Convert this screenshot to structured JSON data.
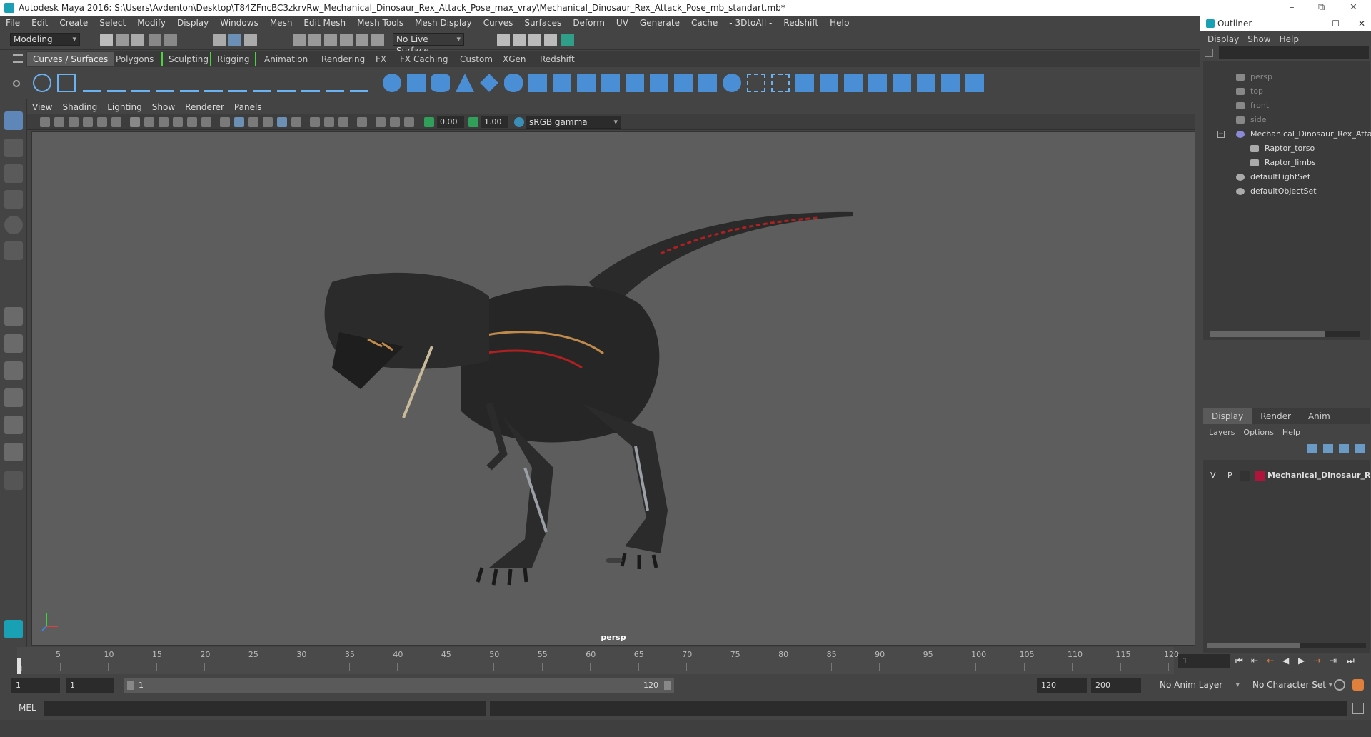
{
  "window": {
    "title": "Autodesk Maya 2016: S:\\Users\\Avdenton\\Desktop\\T84ZFncBC3zkrvRw_Mechanical_Dinosaur_Rex_Attack_Pose_max_vray\\Mechanical_Dinosaur_Rex_Attack_Pose_mb_standart.mb*",
    "controls": [
      "–",
      "⧉",
      "✕"
    ]
  },
  "menubar": [
    "File",
    "Edit",
    "Create",
    "Select",
    "Modify",
    "Display",
    "Windows",
    "Mesh",
    "Edit Mesh",
    "Mesh Tools",
    "Mesh Display",
    "Curves",
    "Surfaces",
    "Deform",
    "UV",
    "Generate",
    "Cache",
    "- 3DtoAll -",
    "Redshift",
    "Help"
  ],
  "statusline": {
    "workspace": "Modeling",
    "live_surface": "No Live Surface"
  },
  "shelf": {
    "tabs": [
      "Curves / Surfaces",
      "Polygons",
      "Sculpting",
      "Rigging",
      "Animation",
      "Rendering",
      "FX",
      "FX Caching",
      "Custom",
      "XGen",
      "Redshift"
    ],
    "active_tab": "Curves / Surfaces"
  },
  "viewport": {
    "menu": [
      "View",
      "Shading",
      "Lighting",
      "Show",
      "Renderer",
      "Panels"
    ],
    "exposure": "0.00",
    "gamma": "1.00",
    "color_space": "sRGB gamma",
    "camera_label": "persp"
  },
  "outliner": {
    "title": "Outliner",
    "menu": [
      "Display",
      "Show",
      "Help"
    ],
    "items": [
      {
        "label": "persp",
        "dim": true
      },
      {
        "label": "top",
        "dim": true
      },
      {
        "label": "front",
        "dim": true
      },
      {
        "label": "side",
        "dim": true
      },
      {
        "label": "Mechanical_Dinosaur_Rex_Attack",
        "dim": false
      },
      {
        "label": "Raptor_torso",
        "dim": false
      },
      {
        "label": "Raptor_limbs",
        "dim": false
      },
      {
        "label": "defaultLightSet",
        "dim": false
      },
      {
        "label": "defaultObjectSet",
        "dim": false
      }
    ]
  },
  "layer_editor": {
    "tabs": [
      "Display",
      "Render",
      "Anim"
    ],
    "menu": [
      "Layers",
      "Options",
      "Help"
    ],
    "layer": {
      "v": "V",
      "p": "P",
      "name": "Mechanical_Dinosaur_Rex_",
      "color": "#b0143a"
    }
  },
  "timeline": {
    "ticks": [
      "5",
      "10",
      "15",
      "20",
      "25",
      "30",
      "35",
      "40",
      "45",
      "50",
      "55",
      "60",
      "65",
      "70",
      "75",
      "80",
      "85",
      "90",
      "95",
      "100",
      "105",
      "110",
      "115",
      "120"
    ],
    "current_frame": "1",
    "start_marker": "1"
  },
  "range": {
    "start": "1",
    "inner_start": "1",
    "slider_start": "1",
    "slider_end": "120",
    "end": "120",
    "anim_end": "200",
    "anim_layer": "No Anim Layer",
    "character_set": "No Character Set"
  },
  "cmdline": {
    "label": "MEL"
  }
}
